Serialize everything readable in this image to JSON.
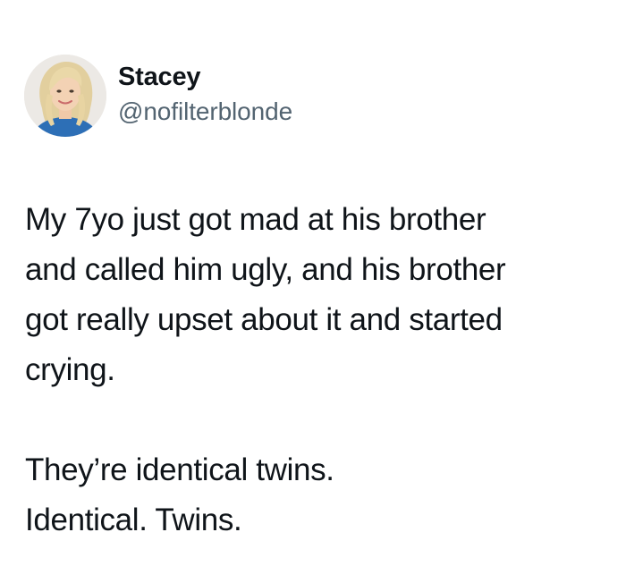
{
  "tweet": {
    "author": {
      "display_name": "Stacey",
      "handle": "@nofilterblonde",
      "avatar_icon": "profile-photo-avatar"
    },
    "paragraphs": [
      [
        "My 7yo just got mad at his brother",
        "and called him ugly, and his brother",
        "got really upset about it and started",
        "crying."
      ],
      [
        "They’re identical twins.",
        "Identical. Twins."
      ]
    ]
  },
  "colors": {
    "background": "#ffffff",
    "text_primary": "#0f1419",
    "text_secondary": "#536471"
  }
}
